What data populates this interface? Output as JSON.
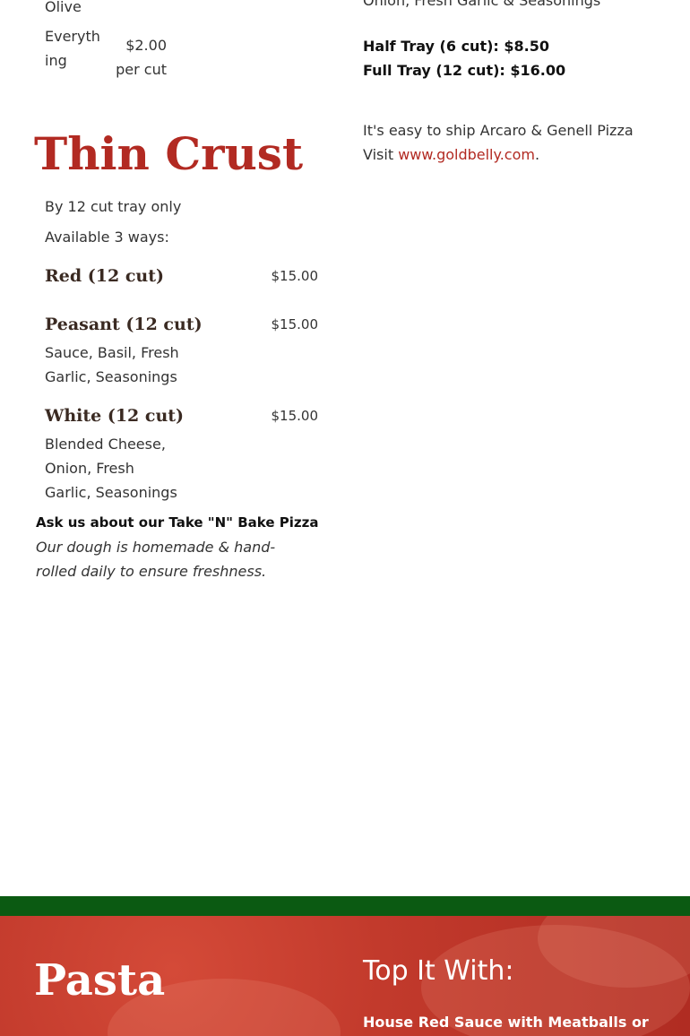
{
  "top_left_items": [
    {
      "name": "Olive",
      "price": ""
    },
    {
      "name": "Everything",
      "price": "$2.00 per cut"
    }
  ],
  "top_right": {
    "ingredients_partial": "Onion, Fresh Garlic & Seasonings",
    "half_tray": "Half Tray (6 cut): $8.50",
    "full_tray": "Full Tray (12 cut): $16.00",
    "ship_text": "It's easy to ship Arcaro & Genell Pizza",
    "visit_prefix": "Visit ",
    "visit_link": "www.goldbelly.com",
    "visit_suffix": "."
  },
  "thin_crust": {
    "title": "Thin Crust",
    "subtitle1": "By 12 cut tray only",
    "subtitle2": "Available 3 ways:",
    "items": [
      {
        "name": "Red (12 cut)",
        "price": "$15.00",
        "desc": ""
      },
      {
        "name": "Peasant (12 cut)",
        "price": "$15.00",
        "desc": "Sauce, Basil, Fresh Garlic, Seasonings"
      },
      {
        "name": "White (12 cut)",
        "price": "$15.00",
        "desc": "Blended Cheese, Onion, Fresh Garlic, Seasonings"
      }
    ],
    "take_n_bake": "Ask us about our Take \"N\" Bake Pizza",
    "dough_note": "Our dough is homemade & hand-rolled daily to ensure freshness."
  },
  "footer_section": {
    "pasta_title": "Pasta",
    "top_it_title": "Top It With:",
    "top_it_first_line": "House Red Sauce with Meatballs or"
  },
  "colors": {
    "accent_red": "#b22a22",
    "green_band": "#0b5a12",
    "red_band": "#c23a2c"
  }
}
